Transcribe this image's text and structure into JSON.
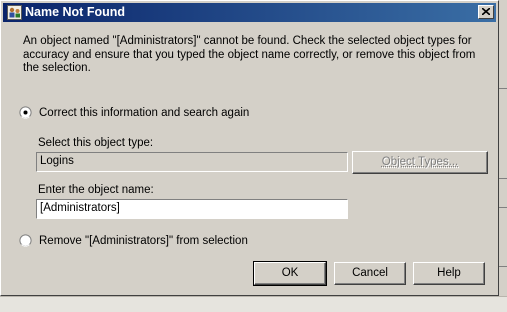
{
  "dialog": {
    "title": "Name Not Found",
    "message": "An object named \"[Administrators]\" cannot be found.  Check the selected object types for accuracy and ensure that you typed the object name correctly, or remove this object from the selection."
  },
  "options": {
    "correct_label": "Correct this information and search again",
    "correct_selected": true,
    "remove_label": "Remove \"[Administrators]\" from selection",
    "remove_selected": false
  },
  "object_type": {
    "label": "Select this object type:",
    "value": "Logins",
    "button_label": "Object Types..."
  },
  "object_name": {
    "label": "Enter the object name:",
    "value": "[Administrators]"
  },
  "buttons": {
    "ok": "OK",
    "cancel": "Cancel",
    "help": "Help"
  }
}
